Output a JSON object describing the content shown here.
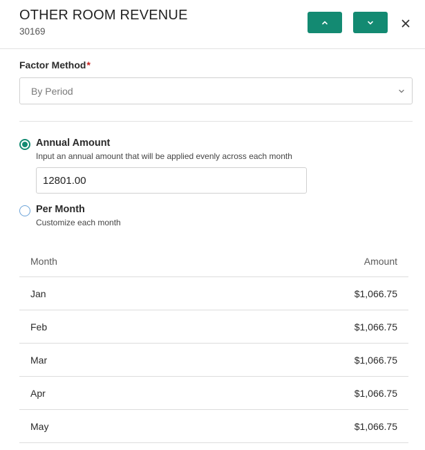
{
  "header": {
    "title": "OTHER ROOM REVENUE",
    "subtitle": "30169",
    "prev_icon": "chevron-up-icon",
    "next_icon": "chevron-down-icon",
    "close_icon": "close-icon"
  },
  "factor_method": {
    "label": "Factor Method",
    "required_mark": "*",
    "selected": "By Period"
  },
  "options": {
    "annual": {
      "title": "Annual Amount",
      "description": "Input an annual amount that will be applied evenly across each month",
      "value": "12801.00",
      "checked": true
    },
    "per_month": {
      "title": "Per Month",
      "description": "Customize each month",
      "checked": false
    }
  },
  "table": {
    "headers": {
      "month": "Month",
      "amount": "Amount"
    },
    "rows": [
      {
        "month": "Jan",
        "amount": "$1,066.75"
      },
      {
        "month": "Feb",
        "amount": "$1,066.75"
      },
      {
        "month": "Mar",
        "amount": "$1,066.75"
      },
      {
        "month": "Apr",
        "amount": "$1,066.75"
      },
      {
        "month": "May",
        "amount": "$1,066.75"
      }
    ]
  },
  "colors": {
    "accent": "#138a72",
    "required": "#c8201e",
    "unchecked_radio": "#6aa2d8"
  }
}
